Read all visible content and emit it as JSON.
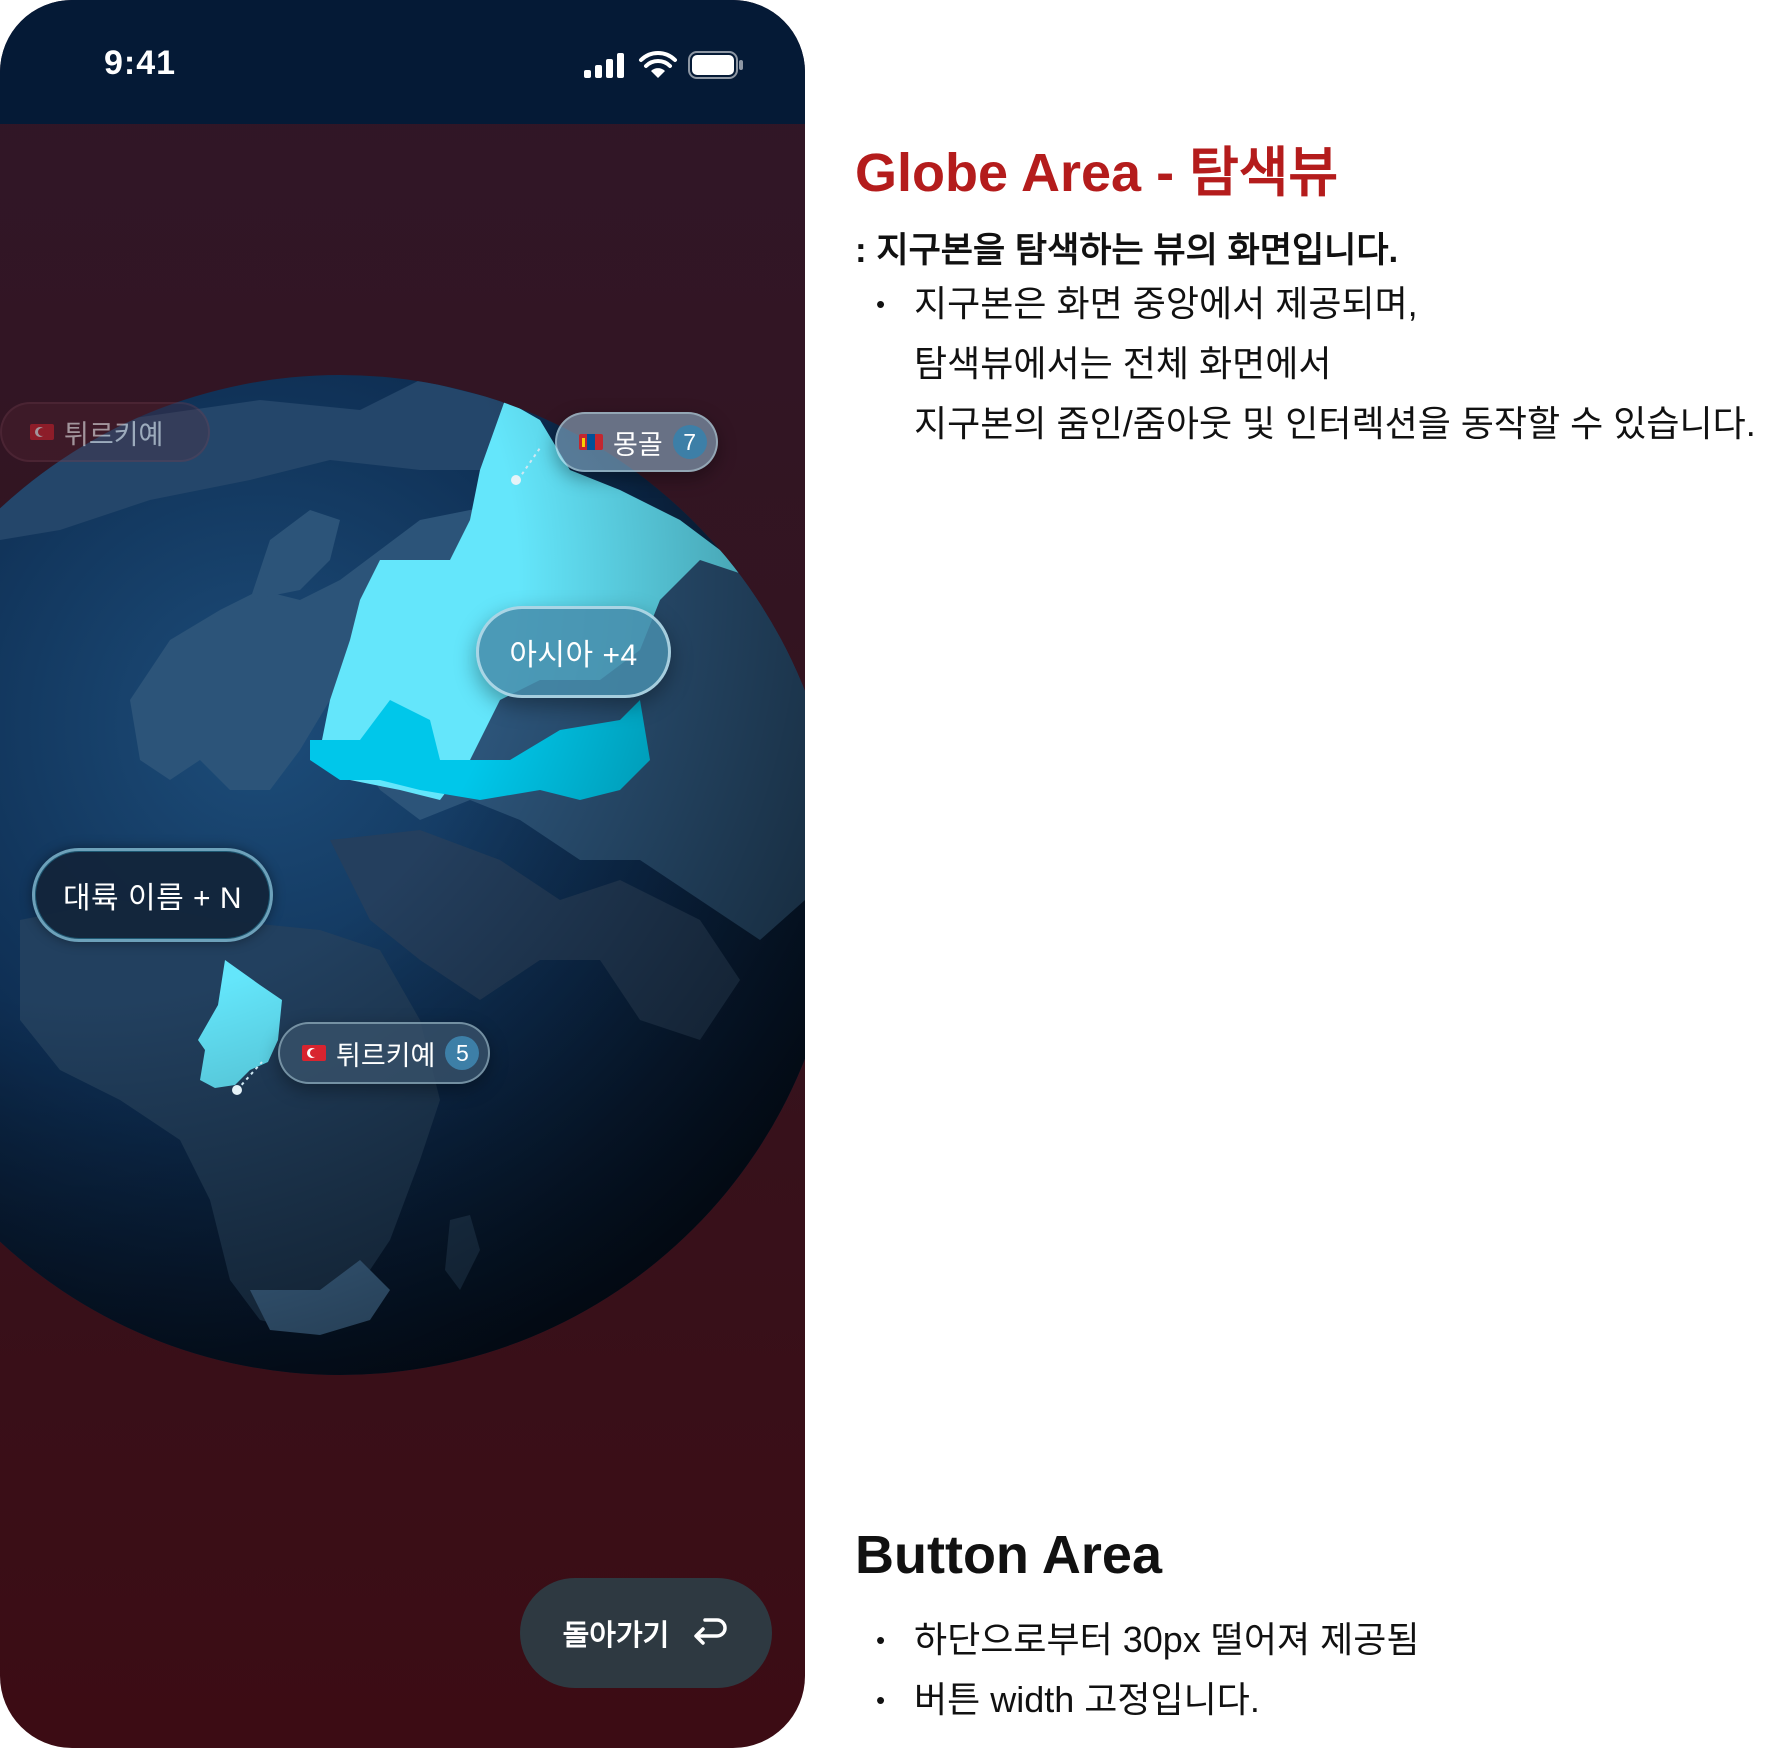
{
  "status_bar": {
    "time": "9:41"
  },
  "globe": {
    "ghost_chip_label": "튀르키예",
    "mongolia_chip": {
      "label": "몽골",
      "count": "7"
    },
    "asia_pill": "아시아 +4",
    "continent_pill": "대륙 이름 + N",
    "turkiye_chip": {
      "label": "튀르키예",
      "count": "5"
    },
    "colors": {
      "ocean": "#0b2646",
      "land": "#2a4d70",
      "highlight": "#64e6fb",
      "highlight_deep": "#00c7ea"
    }
  },
  "back_button": {
    "label": "돌아가기",
    "icon": "return-icon"
  },
  "annotations": {
    "globe_area": {
      "title": "Globe Area - 탐색뷰",
      "subtitle": ": 지구본을 탐색하는 뷰의 화면입니다.",
      "bullet_lines": [
        "지구본은 화면 중앙에서 제공되며,",
        "탐색뷰에서는 전체 화면에서",
        "지구본의 줌인/줌아웃 및 인터렉션을 동작할 수 있습니다."
      ]
    },
    "button_area": {
      "title": "Button Area",
      "bullets": [
        "하단으로부터 30px 떨어져 제공됨",
        "버튼 width 고정입니다."
      ]
    }
  }
}
